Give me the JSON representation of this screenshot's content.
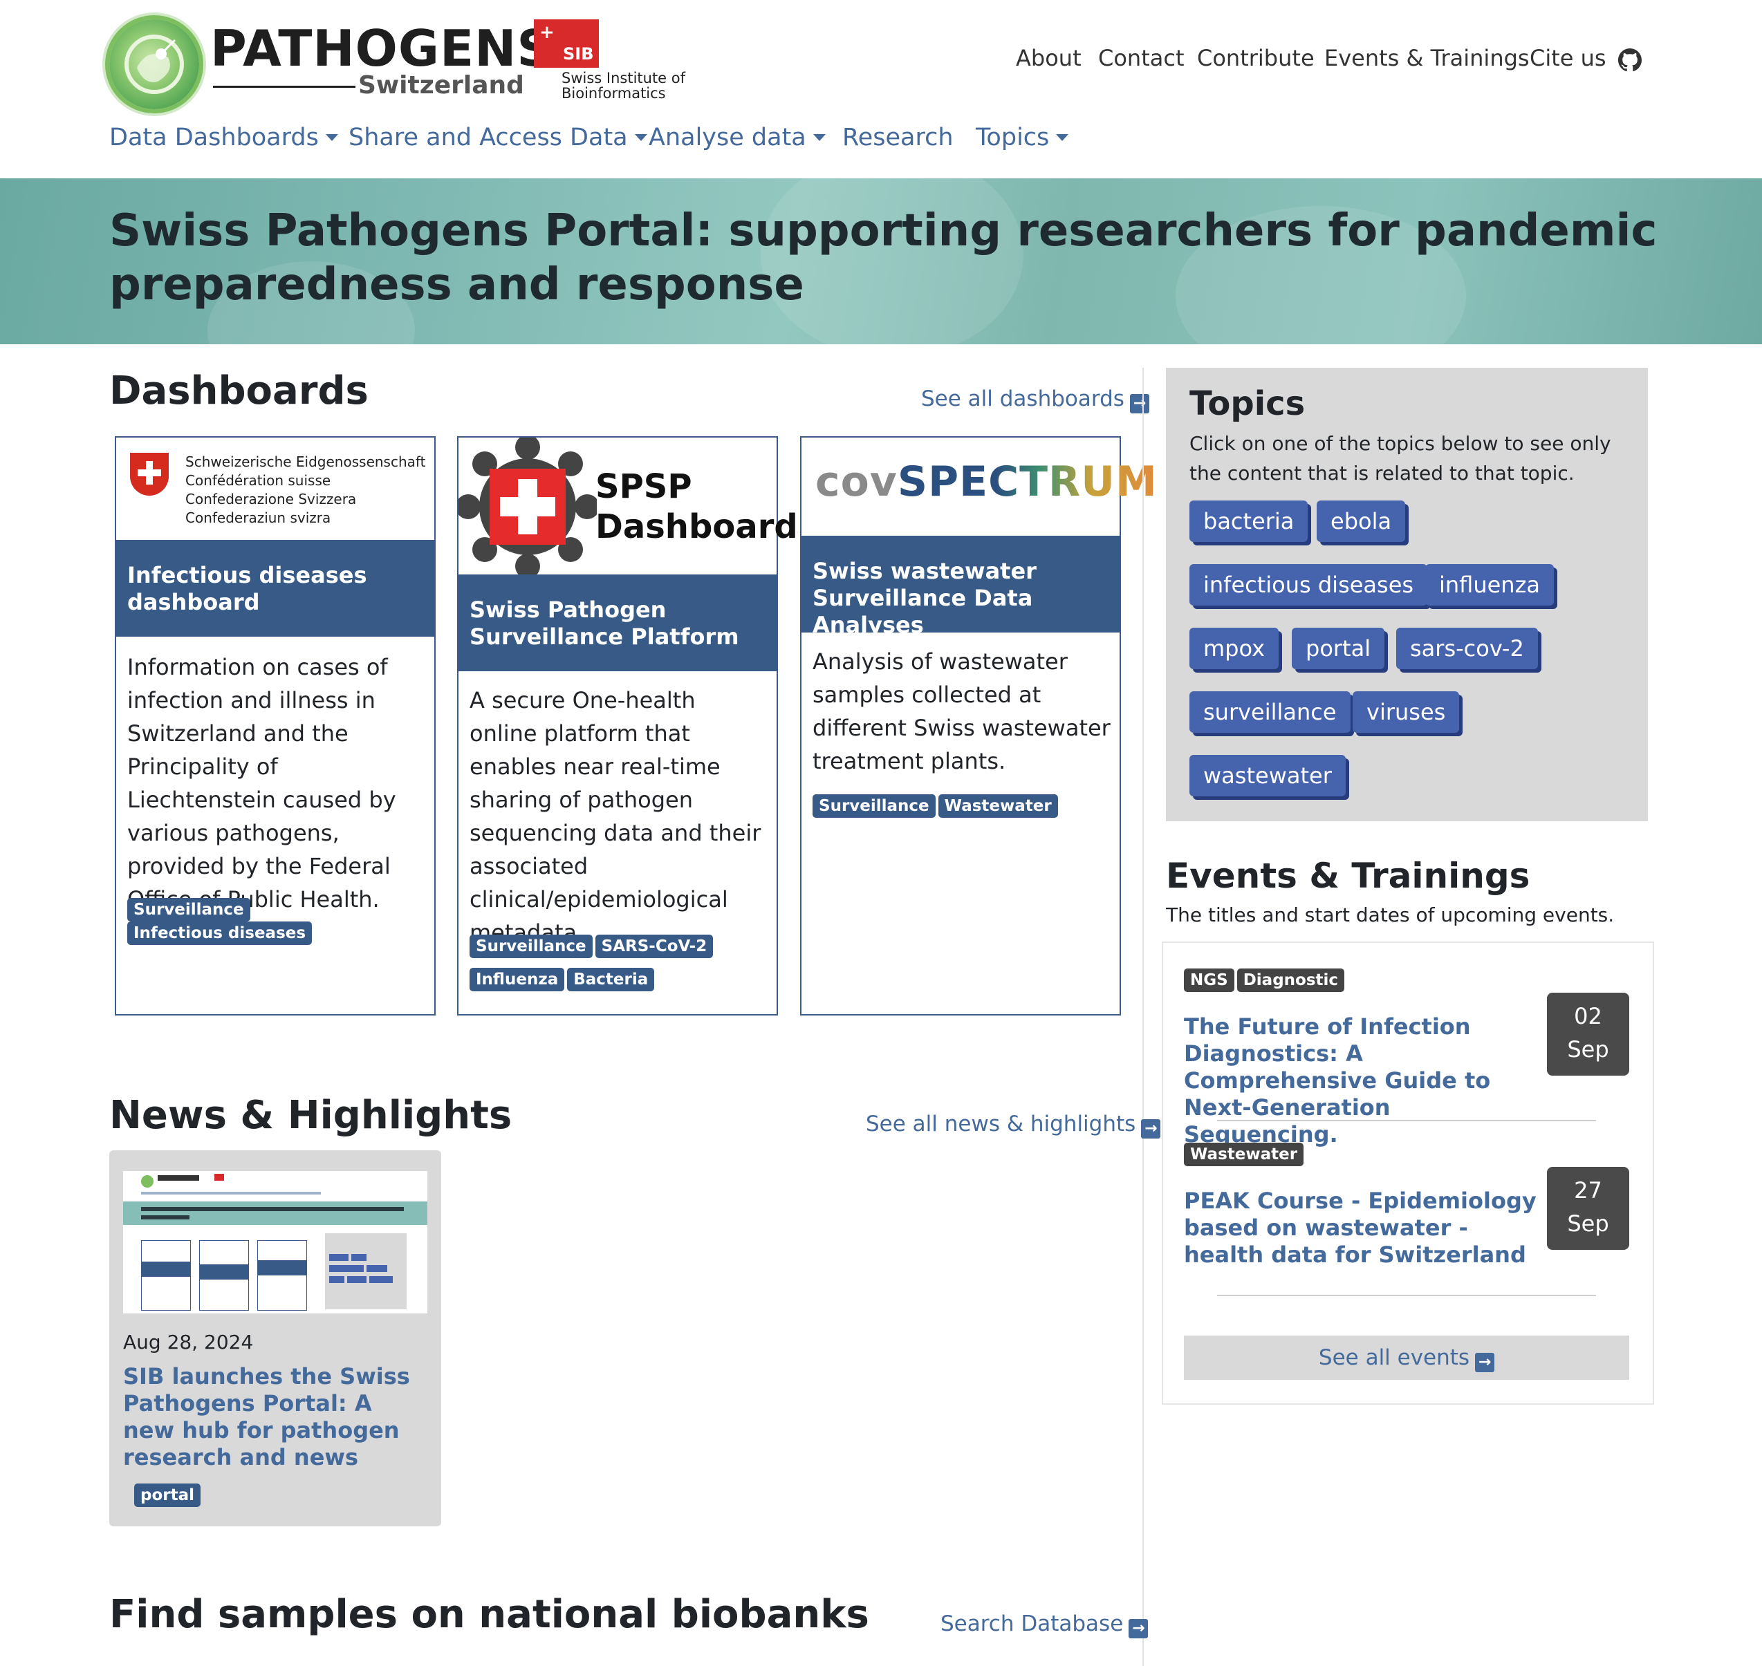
{
  "brand": {
    "title": "PATHOGENS",
    "subtitle": "Switzerland",
    "sib_short": "SIB",
    "sib_full": "Swiss Institute of Bioinformatics"
  },
  "topnav": [
    "About",
    "Contact",
    "Contribute",
    "Events & Trainings",
    "Cite us"
  ],
  "mainnav": [
    {
      "label": "Data Dashboards",
      "dropdown": true
    },
    {
      "label": "Share and Access Data",
      "dropdown": true
    },
    {
      "label": "Analyse data",
      "dropdown": true
    },
    {
      "label": "Research",
      "dropdown": false
    },
    {
      "label": "Topics",
      "dropdown": true
    }
  ],
  "hero": {
    "title": "Swiss Pathogens Portal: supporting researchers for pandemic preparedness and response"
  },
  "dashboards": {
    "heading": "Dashboards",
    "see_all": "See all dashboards",
    "cards": [
      {
        "logo_lines": [
          "Schweizerische Eidgenossenschaft",
          "Confédération suisse",
          "Confederazione Svizzera",
          "Confederaziun svizra"
        ],
        "title": "Infectious diseases dashboard",
        "description": "Information on cases of infection and illness in Switzerland and the Principality of Liechtenstein caused by various pathogens, provided by the Federal Office of Public Health.",
        "tags": [
          "Surveillance",
          "Infectious diseases"
        ]
      },
      {
        "logo_text_1": "SPSP",
        "logo_text_2": "Dashboard",
        "title": "Swiss Pathogen Surveillance Platform",
        "description": "A secure One-health online platform that enables near real-time sharing of pathogen sequencing data and their associated clinical/epidemiological metadata.",
        "tags": [
          "Surveillance",
          "SARS-CoV-2",
          "Influenza",
          "Bacteria"
        ]
      },
      {
        "logo_text_1": "cov",
        "logo_text_2": "SPECTRUM",
        "title": "Swiss wastewater Surveillance Data Analyses",
        "description": "Analysis of wastewater samples collected at different Swiss wastewater treatment plants.",
        "tags": [
          "Surveillance",
          "Wastewater"
        ]
      }
    ]
  },
  "topics": {
    "heading": "Topics",
    "description": "Click on one of the topics below to see only the content that is related to that topic.",
    "items": [
      "bacteria",
      "ebola",
      "infectious diseases",
      "influenza",
      "mpox",
      "portal",
      "sars-cov-2",
      "surveillance",
      "viruses",
      "wastewater"
    ]
  },
  "events": {
    "heading": "Events & Trainings",
    "description": "The titles and start dates of upcoming events.",
    "items": [
      {
        "tags": [
          "NGS",
          "Diagnostic"
        ],
        "title": "The Future of Infection Diagnostics: A Comprehensive Guide to Next-Generation Sequencing.",
        "day": "02",
        "month": "Sep"
      },
      {
        "tags": [
          "Wastewater"
        ],
        "title": "PEAK Course - Epidemiology based on wastewater - health data for Switzerland",
        "day": "27",
        "month": "Sep"
      }
    ],
    "see_all": "See all events"
  },
  "news": {
    "heading": "News & Highlights",
    "see_all": "See all news & highlights",
    "items": [
      {
        "date": "Aug 28, 2024",
        "title": "SIB launches the Swiss Pathogens Portal: A new hub for pathogen research and news",
        "tags": [
          "portal"
        ]
      }
    ]
  },
  "biobanks": {
    "heading": "Find samples on national biobanks",
    "link": "Search Database"
  },
  "colors": {
    "accent": "#44699b",
    "band": "#375a86",
    "topic_pill": "#4663ad",
    "hero": "#80b9b3"
  }
}
